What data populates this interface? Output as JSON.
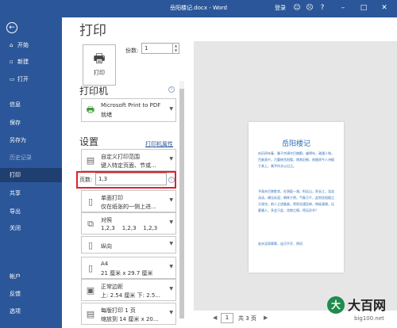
{
  "titlebar": {
    "title": "岳阳楼记.docx  -  Word",
    "login": "登录",
    "icons": [
      "smile-icon",
      "frown-icon",
      "question-icon",
      "minimize-icon",
      "maximize-icon",
      "close-icon"
    ]
  },
  "nav": {
    "back_icon": "back-arrow-icon",
    "items": [
      {
        "label": "开始",
        "icon": "⌂",
        "state": "normal"
      },
      {
        "label": "新建",
        "icon": "□",
        "state": "normal"
      },
      {
        "label": "打开",
        "icon": "▭",
        "state": "normal"
      },
      {
        "label": "信息",
        "icon": "",
        "state": "normal"
      },
      {
        "label": "保存",
        "icon": "",
        "state": "normal"
      },
      {
        "label": "另存为",
        "icon": "",
        "state": "normal"
      },
      {
        "label": "历史记录",
        "icon": "",
        "state": "disabled"
      },
      {
        "label": "打印",
        "icon": "",
        "state": "active"
      },
      {
        "label": "共享",
        "icon": "",
        "state": "normal"
      },
      {
        "label": "导出",
        "icon": "",
        "state": "normal"
      },
      {
        "label": "关闭",
        "icon": "",
        "state": "normal"
      },
      {
        "label": "帐户",
        "icon": "",
        "state": "normal"
      },
      {
        "label": "反馈",
        "icon": "",
        "state": "normal"
      },
      {
        "label": "选项",
        "icon": "",
        "state": "normal"
      }
    ]
  },
  "main": {
    "title": "打印",
    "print_button": "打印",
    "copies_label": "份数:",
    "copies_value": "1",
    "printer_heading": "打印机",
    "printer_name": "Microsoft Print to PDF",
    "printer_status": "就绪",
    "printer_properties": "打印机属性",
    "settings_heading": "设置",
    "settings": {
      "range_line1": "自定义打印范围",
      "range_line2": "键入特定页面、节或...",
      "pages_label": "页数:",
      "pages_value": "1,3",
      "sides_line1": "单面打印",
      "sides_line2": "仅在纸张的一侧上进...",
      "collate_line1": "对照",
      "collate_line2": "1,2,3    1,2,3    1,2,3",
      "orientation": "纵向",
      "paper_line1": "A4",
      "paper_line2": "21 厘米 x 29.7 厘米",
      "margins_line1": "正常边距",
      "margins_line2": "上: 2.54 厘米 下: 2.5...",
      "scale_line1": "每版打印 1 页",
      "scale_line2": "缩放到 14 厘米 x 20..."
    }
  },
  "preview": {
    "doc_title": "岳阳楼记",
    "para1": "庆历四年春，滕子京谪守巴陵郡。越明年，政通人和，百废具兴，乃重修岳阳楼，增其旧制，刻唐贤今人诗赋于其上，属予作文以记之。",
    "para2": "予观夫巴陵胜状，在洞庭一湖。衔远山，吞长江，浩浩汤汤，横无际涯；朝晖夕阴，气象万千，此则岳阳楼之大观也，前人之述备矣。然则北通巫峡，南极潇湘，迁客骚人，多会于此，览物之情，得无异乎？",
    "para3": "若夫淫雨霏霏，连月不开，阴风",
    "page_current": "1",
    "page_total": "共 3 页"
  },
  "watermark": {
    "logo_char": "大",
    "text": "大百网",
    "url": "big100.net"
  }
}
